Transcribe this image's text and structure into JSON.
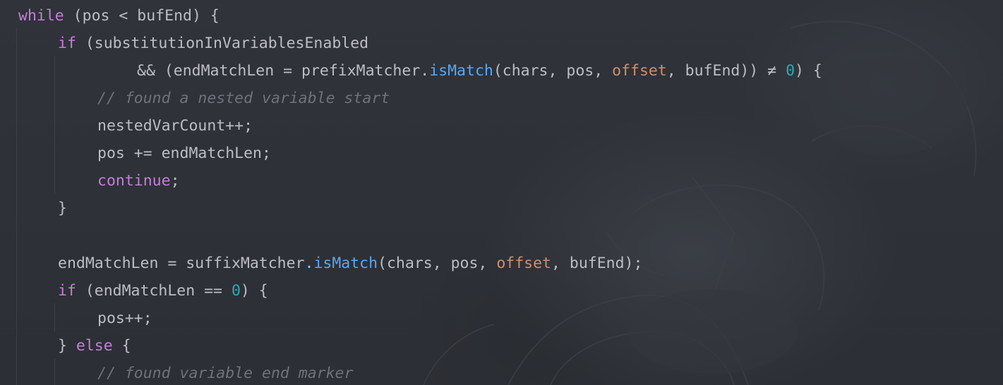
{
  "code": {
    "lines": [
      {
        "indent": 0,
        "tokens": [
          {
            "t": "kw",
            "v": "while"
          },
          {
            "t": "tx",
            "v": " (pos < bufEnd) {"
          }
        ]
      },
      {
        "indent": 1,
        "tokens": [
          {
            "t": "kw",
            "v": "if"
          },
          {
            "t": "tx",
            "v": " (substitutionInVariablesEnabled"
          }
        ]
      },
      {
        "indent": 3,
        "tokens": [
          {
            "t": "tx",
            "v": "&& (endMatchLen = prefixMatcher."
          },
          {
            "t": "fn",
            "v": "isMatch"
          },
          {
            "t": "tx",
            "v": "(chars, pos, "
          },
          {
            "t": "fld",
            "v": "offset"
          },
          {
            "t": "tx",
            "v": ", bufEnd)) ≠ "
          },
          {
            "t": "num",
            "v": "0"
          },
          {
            "t": "tx",
            "v": ") {"
          }
        ]
      },
      {
        "indent": 2,
        "tokens": [
          {
            "t": "cm",
            "v": "// found a nested variable start"
          }
        ]
      },
      {
        "indent": 2,
        "tokens": [
          {
            "t": "tx",
            "v": "nestedVarCount++;"
          }
        ]
      },
      {
        "indent": 2,
        "tokens": [
          {
            "t": "tx",
            "v": "pos += endMatchLen;"
          }
        ]
      },
      {
        "indent": 2,
        "tokens": [
          {
            "t": "kw",
            "v": "continue"
          },
          {
            "t": "tx",
            "v": ";"
          }
        ]
      },
      {
        "indent": 1,
        "tokens": [
          {
            "t": "tx",
            "v": "}"
          }
        ]
      },
      {
        "indent": 0,
        "tokens": []
      },
      {
        "indent": 1,
        "tokens": [
          {
            "t": "tx",
            "v": "endMatchLen = suffixMatcher."
          },
          {
            "t": "fn",
            "v": "isMatch"
          },
          {
            "t": "tx",
            "v": "(chars, pos, "
          },
          {
            "t": "fld",
            "v": "offset"
          },
          {
            "t": "tx",
            "v": ", bufEnd);"
          }
        ]
      },
      {
        "indent": 1,
        "tokens": [
          {
            "t": "kw",
            "v": "if"
          },
          {
            "t": "tx",
            "v": " (endMatchLen == "
          },
          {
            "t": "num",
            "v": "0"
          },
          {
            "t": "tx",
            "v": ") {"
          }
        ]
      },
      {
        "indent": 2,
        "tokens": [
          {
            "t": "tx",
            "v": "pos++;"
          }
        ]
      },
      {
        "indent": 1,
        "tokens": [
          {
            "t": "tx",
            "v": "} "
          },
          {
            "t": "kw",
            "v": "else"
          },
          {
            "t": "tx",
            "v": " {"
          }
        ]
      },
      {
        "indent": 2,
        "tokens": [
          {
            "t": "cm",
            "v": "// found variable end marker"
          }
        ]
      }
    ]
  },
  "colors": {
    "keyword": "#c77dd8",
    "method_call": "#56a8f5",
    "field": "#cf8e6d",
    "number": "#2aacb8",
    "comment": "#6e727a",
    "text": "#bcbec4",
    "background": "#2f3238"
  }
}
